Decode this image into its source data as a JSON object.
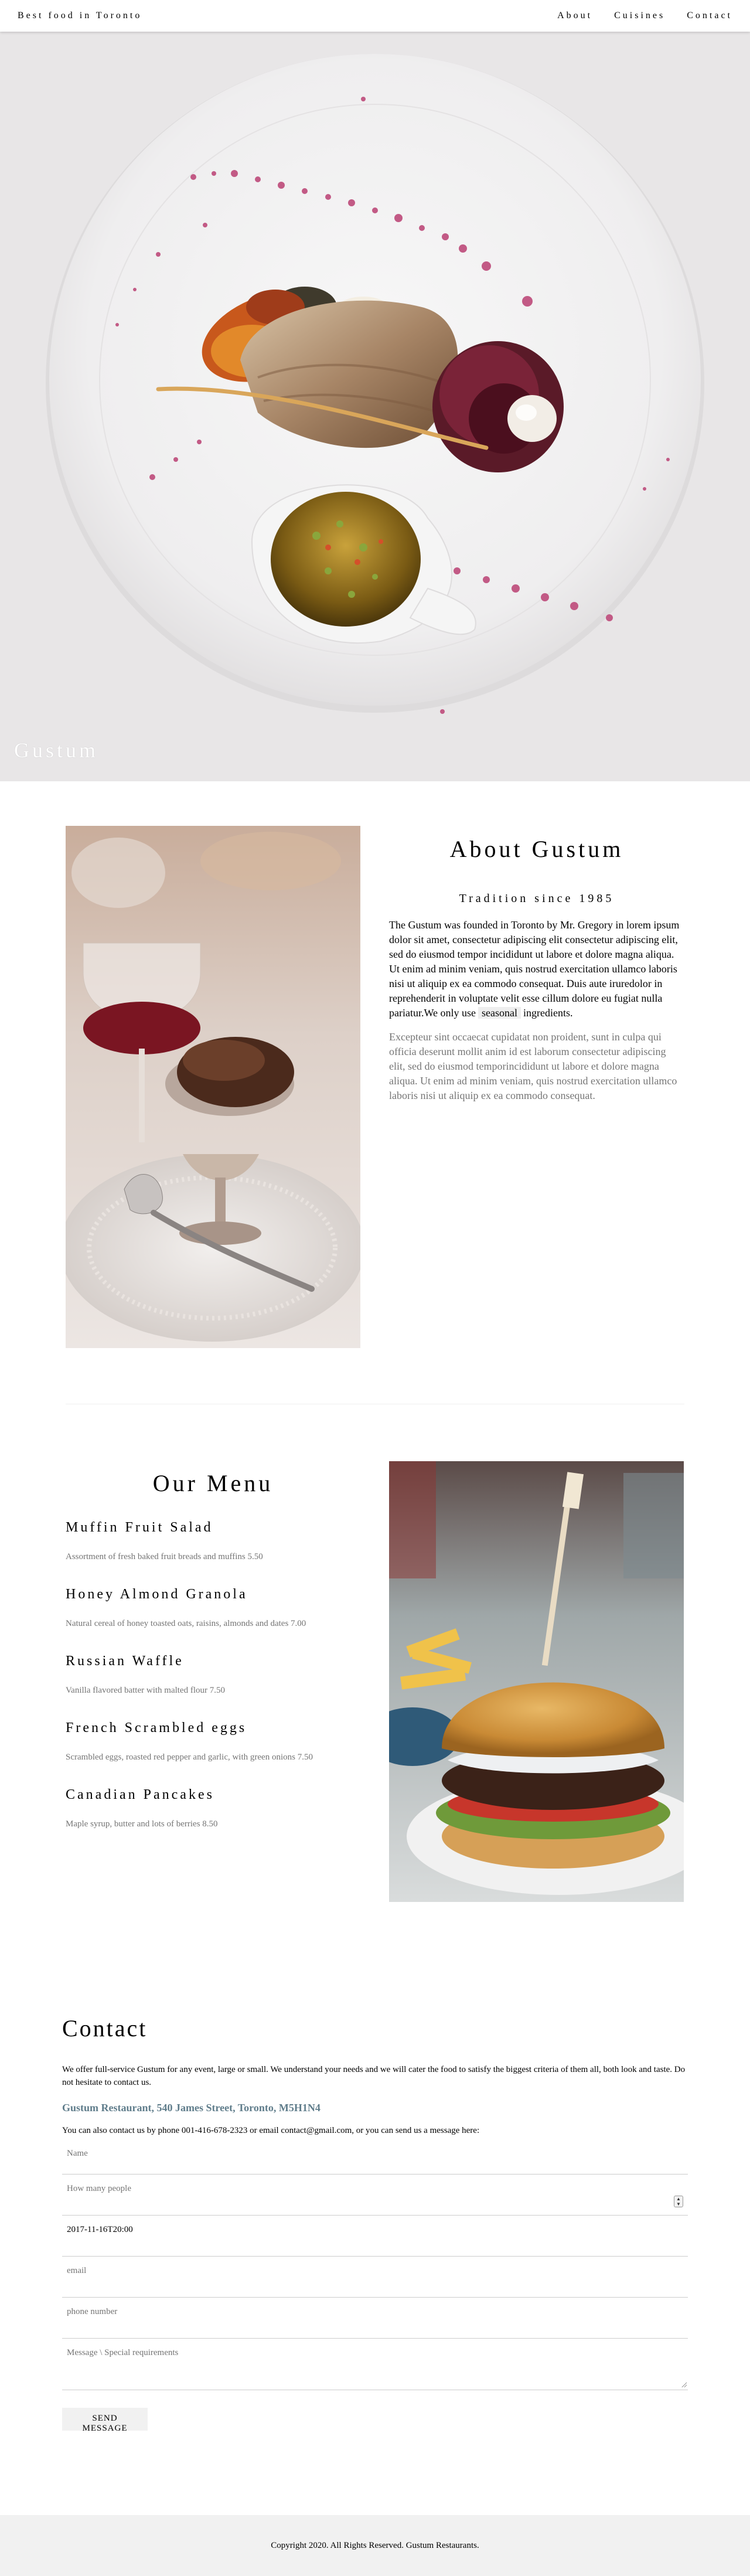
{
  "nav": {
    "brand": "Best food in Toronto",
    "links": [
      "About",
      "Cuisines",
      "Contact"
    ]
  },
  "hero": {
    "title": "Gustum"
  },
  "about": {
    "title": "About Gustum",
    "subtitle": "Tradition since 1985",
    "paragraph1_before": "The Gustum was founded in Toronto by Mr. Gregory in lorem ipsum dolor sit amet, consectetur adipiscing elit consectetur adipiscing elit, sed do eiusmod tempor incididunt ut labore et dolore magna aliqua. Ut enim ad minim veniam, quis nostrud exercitation ullamco laboris nisi ut aliquip ex ea commodo consequat. Duis aute iruredolor in reprehenderit in voluptate velit esse cillum dolore eu fugiat nulla pariatur.We only use",
    "paragraph1_tag": "seasonal",
    "paragraph1_after": "ingredients.",
    "paragraph2": "Excepteur sint occaecat cupidatat non proident, sunt in culpa qui officia deserunt mollit anim id est laborum consectetur adipiscing elit, sed do eiusmod temporincididunt ut labore et dolore magna aliqua. Ut enim ad minim veniam, quis nostrud exercitation ullamco laboris nisi ut aliquip ex ea commodo consequat."
  },
  "menu": {
    "title": "Our Menu",
    "items": [
      {
        "name": "Muffin Fruit Salad",
        "desc": "Assortment of fresh baked fruit breads and muffins 5.50"
      },
      {
        "name": "Honey Almond Granola",
        "desc": "Natural cereal of honey toasted oats, raisins, almonds and dates 7.00"
      },
      {
        "name": "Russian Waffle",
        "desc": "Vanilla flavored batter with malted flour 7.50"
      },
      {
        "name": "French Scrambled eggs",
        "desc": "Scrambled eggs, roasted red pepper and garlic, with green onions 7.50"
      },
      {
        "name": "Canadian Pancakes",
        "desc": "Maple syrup, butter and lots of berries 8.50"
      }
    ]
  },
  "contact": {
    "title": "Contact",
    "intro": "We offer full-service Gustum for any event, large or small. We understand your needs and we will cater the food to satisfy the biggest criteria of them all, both look and taste. Do not hesitate to contact us.",
    "address": "Gustum Restaurant, 540 James Street, Toronto, M5H1N4",
    "phone_line": "You can also contact us by phone 001-416-678-2323 or email contact@gmail.com, or you can send us a message here:",
    "form": {
      "name_placeholder": "Name",
      "people_placeholder": "How many people",
      "datetime_value": "2017-11-16T20:00",
      "email_placeholder": "email",
      "phone_placeholder": "phone number",
      "message_placeholder": "Message \\ Special requirements",
      "submit_label": "SEND MESSAGE"
    }
  },
  "footer": {
    "text": "Copyright 2020. All Rights Reserved. Gustum Restaurants."
  },
  "colors": {
    "accent": "#607d8b",
    "muted_text": "#757575",
    "footer_bg": "#f1f1f1"
  }
}
